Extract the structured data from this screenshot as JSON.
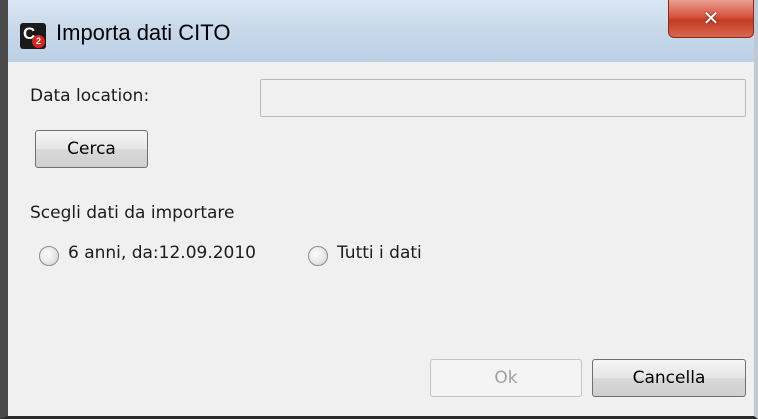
{
  "window": {
    "title": "Importa dati CITO",
    "app_icon_letter": "C",
    "app_icon_digit": "2",
    "close_glyph": "✕"
  },
  "form": {
    "location_label": "Data location:",
    "location_value": "",
    "search_button": "Cerca",
    "choose_label": "Scegli dati da importare",
    "options": [
      {
        "label": "6 anni, da:12.09.2010",
        "selected": false
      },
      {
        "label": "Tutti i dati",
        "selected": false
      }
    ]
  },
  "footer": {
    "ok_label": "Ok",
    "ok_enabled": false,
    "cancel_label": "Cancella"
  },
  "colors": {
    "close_button": "#d9533e",
    "titlebar": "#c9d9ea",
    "dialog_bg": "#f0f0f0"
  }
}
